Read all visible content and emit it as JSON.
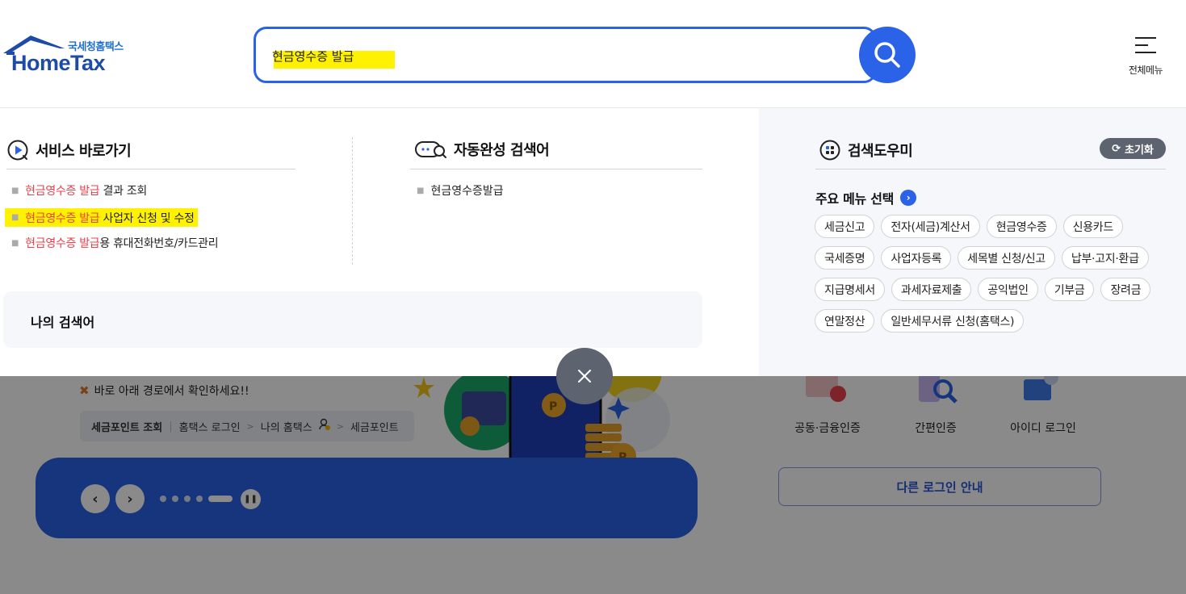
{
  "header": {
    "logo_sub": "국세청홈택스",
    "logo_main": "HomeTax",
    "search_value": "현금영수증 발급",
    "menu_label": "전체메뉴"
  },
  "service_shortcut": {
    "title": "서비스 바로가기",
    "items": [
      {
        "highlight": "현금영수증 발급",
        "rest": " 결과 조회"
      },
      {
        "highlight": "현금영수증 발급",
        "rest": " 사업자 신청 및 수정"
      },
      {
        "highlight": "현금영수증 발급",
        "rest": "용 휴대전화번호/카드관리"
      }
    ]
  },
  "autocomplete": {
    "title": "자동완성 검색어",
    "items": [
      "현금영수증발급"
    ]
  },
  "my_search": {
    "title": "나의 검색어"
  },
  "search_helper": {
    "title": "검색도우미",
    "reset_label": "초기화",
    "main_menu_title": "주요 메뉴 선택",
    "chips": [
      "세금신고",
      "전자(세금)계산서",
      "현금영수증",
      "신용카드",
      "국세증명",
      "사업자등록",
      "세목별 신청/신고",
      "납부·고지·환급",
      "지급명세서",
      "과세자료제출",
      "공익법인",
      "기부금",
      "장려금",
      "연말정산",
      "일반세무서류 신청(홈택스)"
    ]
  },
  "background": {
    "notice": "바로 아래 경로에서 확인하세요!!",
    "path": {
      "title": "세금포인트 조회",
      "steps": [
        "홈택스 로그인",
        "나의 홈택스",
        "세금포인트"
      ]
    },
    "login_options": [
      "공동·금융인증",
      "간편인증",
      "아이디 로그인"
    ],
    "other_login": "다른 로그인 안내",
    "carousel": {
      "total_slides": 5,
      "current_slide": 5
    }
  },
  "colors": {
    "brand_blue": "#2a62e8",
    "highlight_yellow": "#fff200",
    "keyword_red": "#e8414c"
  }
}
